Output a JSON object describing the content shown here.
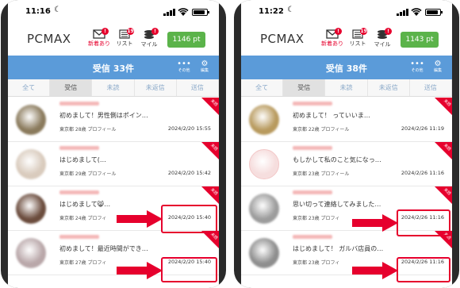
{
  "screenshots": [
    {
      "status_time": "11:16",
      "moon_icon": "☾",
      "logo": "PCMAX",
      "header": {
        "mail_label": "新着あり",
        "list_label": "リスト",
        "list_badge": "19",
        "mile_label": "マイル",
        "mile_badge": "!",
        "mail_badge": "!",
        "points": "1146 pt"
      },
      "inbox_title": "受信 33件",
      "more_label": "その他",
      "edit_label": "編集",
      "tabs": [
        "全て",
        "受信",
        "未読",
        "未返信",
        "送信"
      ],
      "active_tab": 1,
      "messages": [
        {
          "text": "初めまして！男性側はポイン…",
          "meta": "東京都 28歳 プロフィール",
          "date": "2024/2/20 15:55",
          "badge": "未読",
          "avatar_color": "#8a7a5c"
        },
        {
          "text": "はじめまして(…",
          "meta": "東京都 29歳 プロフィール",
          "date": "2024/2/20 15:42",
          "badge": "未読",
          "avatar_color": "#d9cbbd"
        },
        {
          "text": "はじめまして😸…",
          "meta": "東京都 24歳 プロフィ",
          "date": "2024/2/20 15:40",
          "badge": "未読",
          "avatar_color": "#6b4c3d"
        },
        {
          "text": "初めまして！最近時間ができ…",
          "meta": "東京都 27歳 プロフィ",
          "date": "2024/2/20 15:40",
          "badge": "未読",
          "avatar_color": "#b9a7a9"
        }
      ]
    },
    {
      "status_time": "11:22",
      "moon_icon": "☾",
      "logo": "PCMAX",
      "header": {
        "mail_label": "新着あり",
        "list_label": "リスト",
        "list_badge": "19",
        "mile_label": "マイル",
        "mile_badge": "!",
        "mail_badge": "!",
        "points": "1143 pt"
      },
      "inbox_title": "受信 38件",
      "more_label": "その他",
      "edit_label": "編集",
      "tabs": [
        "全て",
        "受信",
        "未読",
        "未返信",
        "送信"
      ],
      "active_tab": 1,
      "messages": [
        {
          "text": "初めまして！ っていいま…",
          "meta": "東京都 22歳 プロフィール",
          "date": "2024/2/26 11:19",
          "badge": "未読",
          "avatar_color": "#b89a5e"
        },
        {
          "text": "もしかして私のこと気になっ…",
          "meta": "東京都 23歳 プロフィール",
          "date": "2024/2/26 11:16",
          "badge": "未読",
          "avatar_color": "#f6dede",
          "blank": true
        },
        {
          "text": "思い切って連絡してみました…",
          "meta": "東京都 23歳 プロフィ",
          "date": "2024/2/26 11:16",
          "badge": "未読",
          "avatar_color": "#9c9c9c"
        },
        {
          "text": "はじめまして！ ガルバ店員の…",
          "meta": "東京都 23歳 プロフィ",
          "date": "2024/2/26 11:16",
          "badge": "未読",
          "avatar_color": "#8e8e8e"
        }
      ]
    }
  ],
  "highlight_color": "#e6002d",
  "brand_blue": "#5b9bd9",
  "points_green": "#5bb34a"
}
